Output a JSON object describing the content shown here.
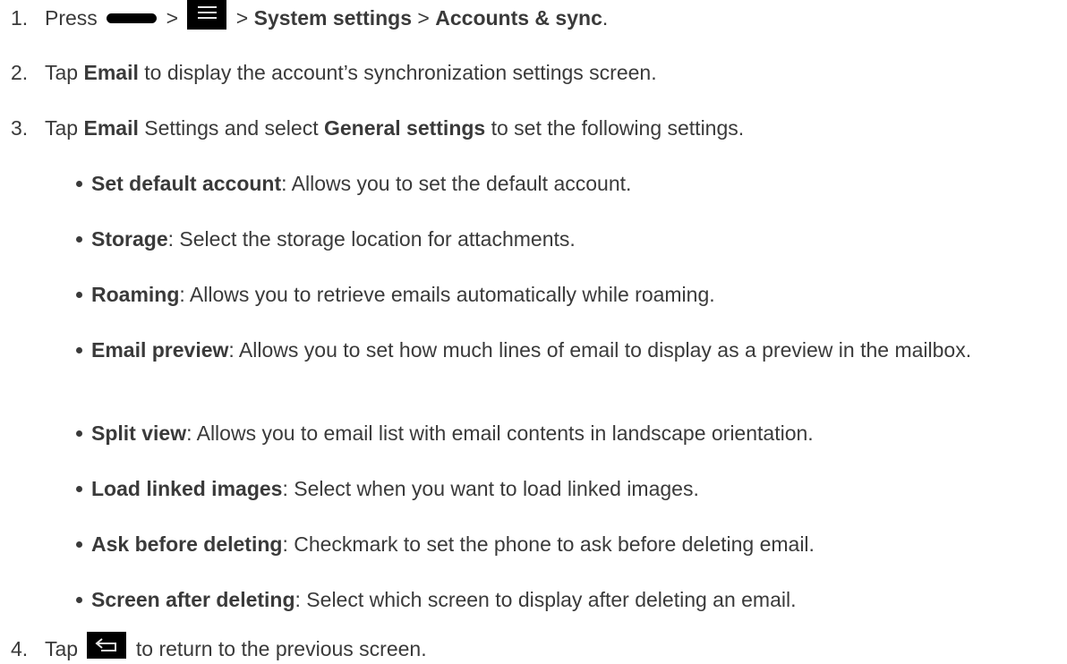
{
  "steps": [
    {
      "number": "1.",
      "parts": {
        "press": "Press",
        "sep1": ">",
        "sep2": ">",
        "system_settings": "System settings",
        "sep3": ">",
        "accounts_sync": "Accounts & sync",
        "end": "."
      }
    },
    {
      "number": "2.",
      "parts": {
        "tap": "Tap",
        "email": "Email",
        "rest": "to display the account’s synchronization settings screen."
      }
    },
    {
      "number": "3.",
      "parts": {
        "tap": "Tap",
        "email": "Email",
        "mid": "Settings and select",
        "general": "General settings",
        "rest": "to set the following settings."
      }
    },
    {
      "number": "4.",
      "parts": {
        "tap": "Tap",
        "rest": "to return to the previous screen."
      }
    }
  ],
  "settings": [
    {
      "term": "Set default account",
      "desc": ": Allows you to set the default account."
    },
    {
      "term": "Storage",
      "desc": ": Select the storage location for attachments."
    },
    {
      "term": "Roaming",
      "desc": ": Allows you to retrieve emails automatically while roaming."
    },
    {
      "term": "Email preview",
      "desc": ": Allows you to set how much lines of email to display as a preview in the mailbox."
    },
    {
      "term": "Split view",
      "desc": ": Allows you to email list with email contents in landscape orientation."
    },
    {
      "term": "Load linked images",
      "desc": ": Select when you want to load linked images."
    },
    {
      "term": "Ask before deleting",
      "desc": ": Checkmark to set the phone to ask before deleting email."
    },
    {
      "term": "Screen after deleting",
      "desc": ": Select which screen to display after deleting an email."
    }
  ],
  "icons": {
    "home": "home-key-icon",
    "menu": "menu-key-icon",
    "back": "back-key-icon"
  },
  "colors": {
    "text": "#3a3a3a",
    "key_background": "#000000"
  }
}
